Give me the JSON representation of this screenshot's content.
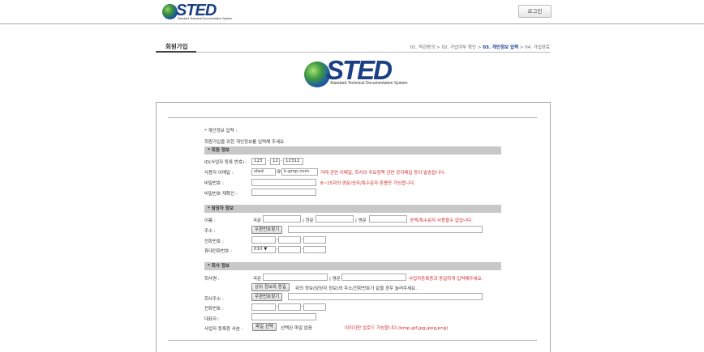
{
  "header": {
    "logo_text": "STED",
    "logo_subtitle": "Standard Technical Documentation System",
    "login_label": "로그인"
  },
  "page": {
    "title": "회원가입",
    "steps": {
      "step1": "01. 약관동의 > ",
      "step2": "02. 가입여부 확인 > ",
      "step3": "03. 개인정보 입력",
      "step4": " > 04. 가입완료"
    }
  },
  "brand": {
    "logo_text": "STED",
    "logo_subtitle": "Standard Technical Documentation System"
  },
  "form": {
    "heading": "* 개인정보 입력 :",
    "intro": "회원가입을 위한 개인정보를 입력해 주세요",
    "member": {
      "section_title": "* 회원 정보",
      "biz_no_label": "ID(사업자 등록 번호) :",
      "biz_no_1": "123",
      "biz_no_2": "12",
      "biz_no_3": "12312",
      "dash": "-",
      "email_label": "사용자 이메일 :",
      "email_id": "sted",
      "at": "@",
      "email_domain": "k-gmp.com",
      "email_note": "거래 관련 이메일, 회사의 주요정책 관련 공지메일 등이 발송됩니다.",
      "password_label": "비밀번호 :",
      "password_note": "8~15자의 영문/숫자/특수문자 혼용만 가능합니다.",
      "password_confirm_label": "비밀번호 재확인 :"
    },
    "manager": {
      "section_title": "* 담당자 정보",
      "name_label": "이름 :",
      "korean_label": "국문",
      "chinese_label": "| 한문",
      "english_label": "| 영문",
      "name_note": "공백/특수문자 사용할수 없습니다.",
      "address_label": "주소 :",
      "zip_button": "우편번호찾기",
      "phone_label": "전화번호 :",
      "mobile_label": "휴대전화번호 :",
      "mobile_prefix": "010 ▼"
    },
    "company": {
      "section_title": "* 회사 정보",
      "company_name_label": "회사명 :",
      "korean_label": "국문",
      "english_label": "| 영문",
      "company_name_note": "사업자등록증과 동일하게 입력해주세요.",
      "same_button": "상위 정보와 동일",
      "same_note": "위의 정보(담당자 정보)와 주소/전화번호가 같을 경우 눌러주세요.",
      "address_label": "회사주소 :",
      "zip_button": "우편번호찾기",
      "phone_label": "전화번호 :",
      "ceo_label": "대표자 :",
      "cert_label": "사업자 등록증 사본 :",
      "file_button": "파일 선택",
      "file_status": "선택된 파일 없음",
      "file_note": "이미지만 업로드 가능합니다.(bmp,gif,jpg,jpeg,png)"
    }
  }
}
